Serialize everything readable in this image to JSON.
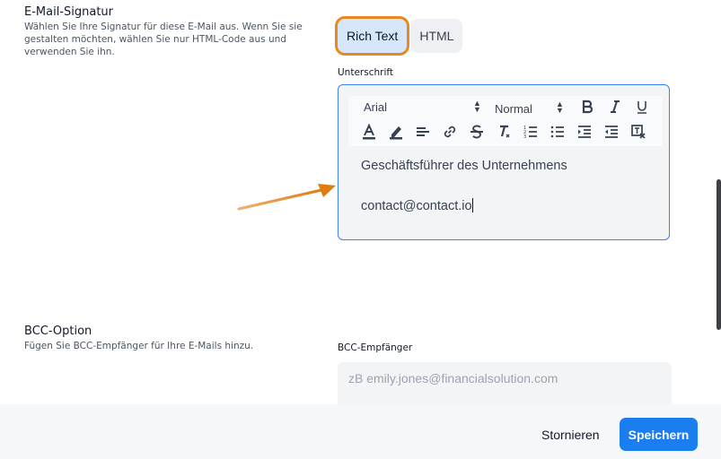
{
  "signature_section": {
    "title": "E-Mail-Signatur",
    "description": "Wählen Sie Ihre Signatur für diese E-Mail aus. Wenn Sie sie gestalten möchten, wählen Sie nur HTML-Code aus und verwenden Sie ihn.",
    "modes": [
      {
        "label": "Rich Text",
        "active": true
      },
      {
        "label": "HTML",
        "active": false
      }
    ],
    "editor_label": "Unterschrift",
    "toolbar": {
      "font_select": "Arial",
      "size_select": "Normal",
      "icons": [
        "bold-icon",
        "italic-icon",
        "underline-icon",
        "text-color-icon",
        "highlight-icon",
        "align-icon",
        "link-icon",
        "strikethrough-icon",
        "clear-format-icon",
        "ordered-list-icon",
        "bullet-list-icon",
        "indent-icon",
        "outdent-icon",
        "remove-format-icon"
      ]
    },
    "content": {
      "line1": "Geschäftsführer des Unternehmens",
      "line2": "contact@contact.io"
    }
  },
  "bcc_section": {
    "title": "BCC-Option",
    "description": "Fügen Sie BCC-Empfänger für Ihre E-Mails hinzu.",
    "field_label": "BCC-Empfänger",
    "placeholder": "zB emily.jones@financialsolution.com"
  },
  "footer": {
    "cancel_label": "Stornieren",
    "save_label": "Speichern"
  },
  "colors": {
    "accent": "#1a7df0",
    "highlight_outline": "#e8891f",
    "editor_border": "#3b82f6"
  }
}
